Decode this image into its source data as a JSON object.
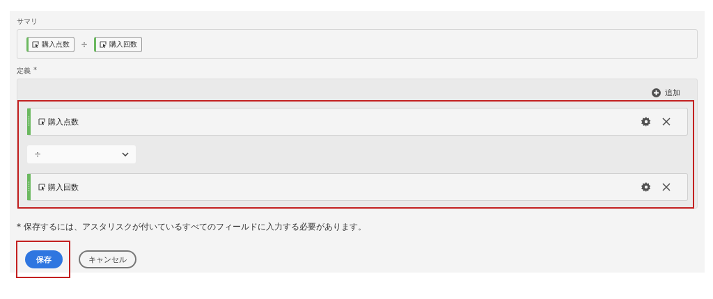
{
  "summary": {
    "label": "サマリ",
    "parts": [
      {
        "kind": "metric",
        "text": "購入点数"
      },
      {
        "kind": "operator",
        "text": "÷"
      },
      {
        "kind": "metric",
        "text": "購入回数"
      }
    ]
  },
  "definition": {
    "label": "定義",
    "required_mark": "*",
    "add_label": "追加",
    "highlighted": true,
    "items": [
      {
        "kind": "metric",
        "text": "購入点数"
      },
      {
        "kind": "operator",
        "text": "÷"
      },
      {
        "kind": "metric",
        "text": "購入回数"
      }
    ]
  },
  "note": "* 保存するには、アスタリスクが付いているすべてのフィールドに入力する必要があります。",
  "buttons": [
    {
      "kind": "primary",
      "label": "保存",
      "highlighted": true
    },
    {
      "kind": "secondary",
      "label": "キャンセル",
      "highlighted": false
    }
  ]
}
